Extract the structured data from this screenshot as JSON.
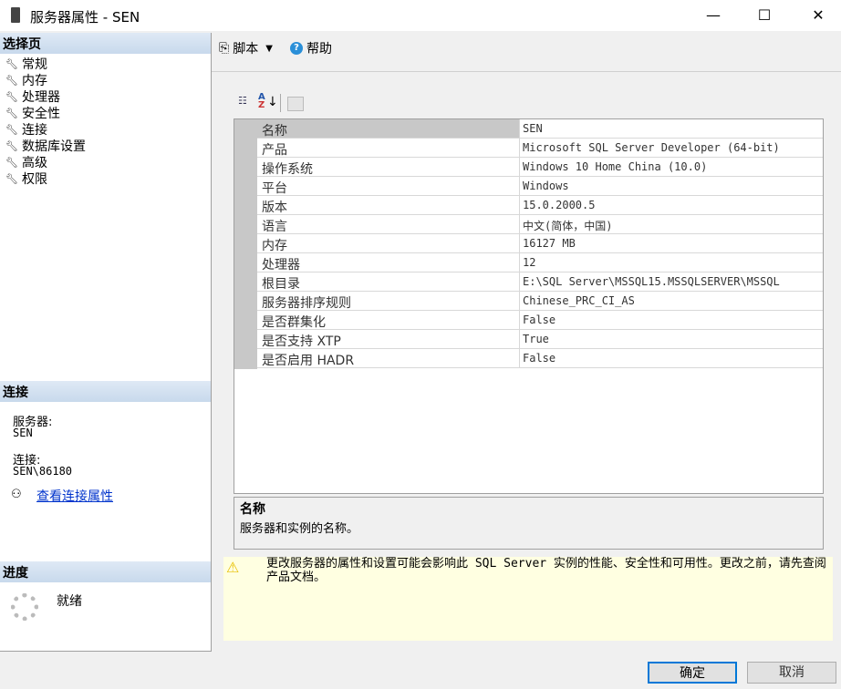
{
  "window": {
    "title": "服务器属性 - SEN",
    "minimize": "—",
    "maximize": "☐",
    "close": "✕"
  },
  "sidebar": {
    "header": "选择页",
    "items": [
      "常规",
      "内存",
      "处理器",
      "安全性",
      "连接",
      "数据库设置",
      "高级",
      "权限"
    ]
  },
  "connection": {
    "header": "连接",
    "server_label": "服务器:",
    "server_value": "SEN",
    "conn_label": "连接:",
    "conn_value": "SEN\\86180",
    "view_link": "查看连接属性"
  },
  "progress": {
    "header": "进度",
    "status": "就绪"
  },
  "toolbar": {
    "script": "脚本",
    "help": "帮助"
  },
  "properties": [
    {
      "name": "名称",
      "value": "SEN"
    },
    {
      "name": "产品",
      "value": "Microsoft SQL Server Developer (64-bit)"
    },
    {
      "name": "操作系统",
      "value": "Windows 10 Home China (10.0)"
    },
    {
      "name": "平台",
      "value": "Windows"
    },
    {
      "name": "版本",
      "value": "15.0.2000.5"
    },
    {
      "name": "语言",
      "value": "中文(简体，中国)"
    },
    {
      "name": "内存",
      "value": "16127 MB"
    },
    {
      "name": "处理器",
      "value": "12"
    },
    {
      "name": "根目录",
      "value": "E:\\SQL Server\\MSSQL15.MSSQLSERVER\\MSSQL"
    },
    {
      "name": "服务器排序规则",
      "value": "Chinese_PRC_CI_AS"
    },
    {
      "name": "是否群集化",
      "value": "False"
    },
    {
      "name": "是否支持 XTP",
      "value": "True"
    },
    {
      "name": "是否启用 HADR",
      "value": "False"
    }
  ],
  "description": {
    "title": "名称",
    "text": "服务器和实例的名称。"
  },
  "warning": "更改服务器的属性和设置可能会影响此 SQL Server 实例的性能、安全性和可用性。更改之前，请先查阅产品文档。",
  "buttons": {
    "ok": "确定",
    "cancel": "取消"
  }
}
